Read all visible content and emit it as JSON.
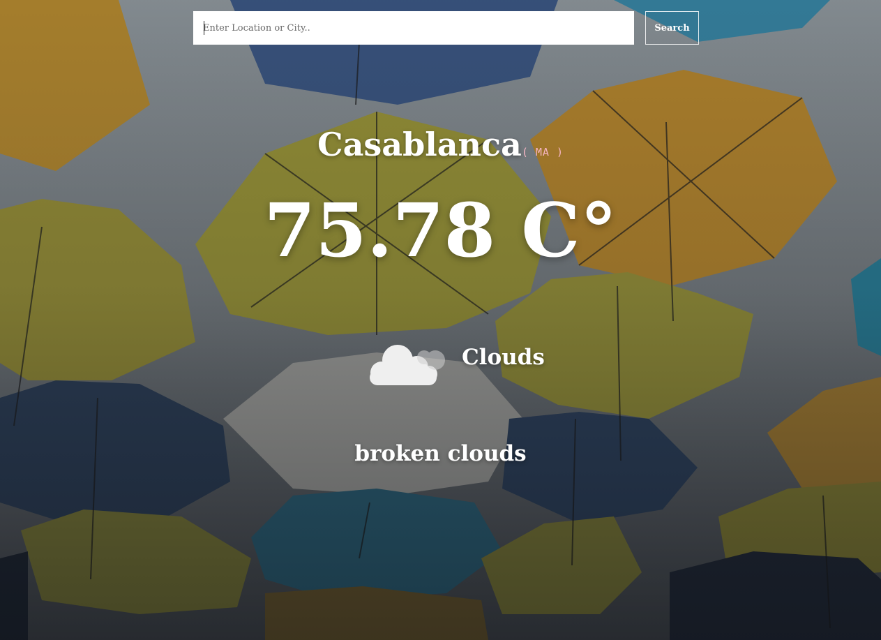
{
  "search": {
    "placeholder": "Enter Location or City..",
    "value": "",
    "button_label": "Search"
  },
  "weather": {
    "city": "Casablanca",
    "country_code": "( MA )",
    "temperature": "75.78 C°",
    "condition": "Clouds",
    "description": "broken clouds",
    "icon": "cloud-icon"
  },
  "colors": {
    "country_code": "#f7b6c4",
    "text": "#ffffff",
    "search_field": "#ffffff"
  }
}
